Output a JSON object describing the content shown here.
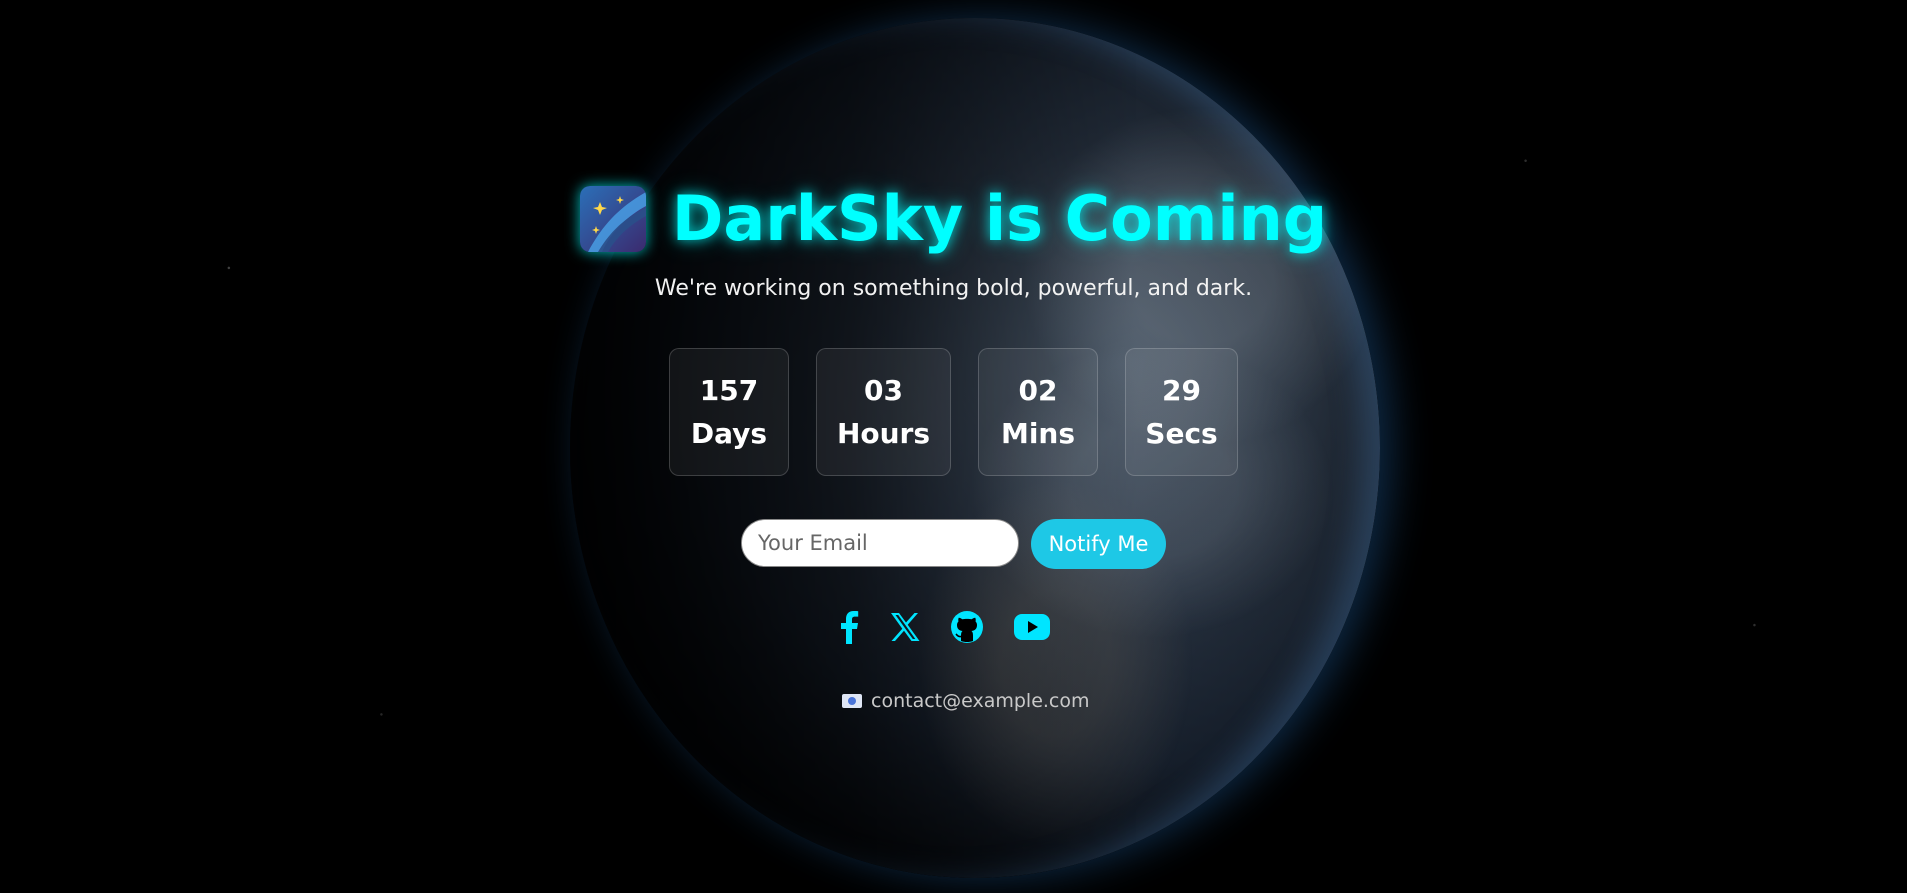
{
  "hero": {
    "title": "DarkSky is Coming",
    "subtitle": "We're working on something bold, powerful, and dark.",
    "logo_icon": "shooting-star-sky-icon"
  },
  "countdown": [
    {
      "value": "157",
      "label": "Days"
    },
    {
      "value": "03",
      "label": "Hours"
    },
    {
      "value": "02",
      "label": "Mins"
    },
    {
      "value": "29",
      "label": "Secs"
    }
  ],
  "signup": {
    "email_placeholder": "Your Email",
    "email_value": "",
    "button_label": "Notify Me"
  },
  "socials": [
    {
      "name": "facebook-icon"
    },
    {
      "name": "x-twitter-icon"
    },
    {
      "name": "github-icon"
    },
    {
      "name": "youtube-icon"
    }
  ],
  "contact": {
    "email": "contact@example.com",
    "icon": "envelope-icon"
  },
  "colors": {
    "accent": "#00ffff",
    "button": "#1ec8e6",
    "background": "#000000"
  }
}
